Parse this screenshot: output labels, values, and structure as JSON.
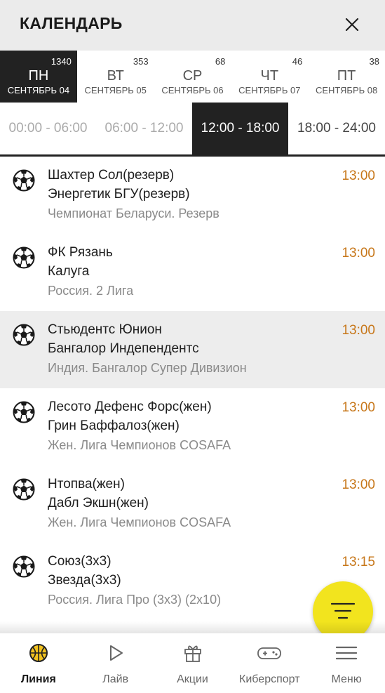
{
  "header": {
    "title": "КАЛЕНДАРЬ",
    "close_icon": "close-icon"
  },
  "days": [
    {
      "count": "1340",
      "name": "ПН",
      "date": "СЕНТЯБРЬ 04",
      "active": true
    },
    {
      "count": "353",
      "name": "ВТ",
      "date": "СЕНТЯБРЬ 05",
      "active": false
    },
    {
      "count": "68",
      "name": "СР",
      "date": "СЕНТЯБРЬ 06",
      "active": false
    },
    {
      "count": "46",
      "name": "ЧТ",
      "date": "СЕНТЯБРЬ 07",
      "active": false
    },
    {
      "count": "38",
      "name": "ПТ",
      "date": "СЕНТЯБРЬ 08",
      "active": false
    }
  ],
  "slots": [
    "00:00 - 06:00",
    "06:00 - 12:00",
    "12:00 - 18:00",
    "18:00 - 24:00"
  ],
  "active_slot": "12:00 - 18:00",
  "events": [
    {
      "team1": "Шахтер Сол(резерв)",
      "team2": "Энергетик БГУ(резерв)",
      "league": "Чемпионат Беларуси. Резерв",
      "time": "13:00",
      "sport_icon": "soccer-ball-icon"
    },
    {
      "team1": "ФК Рязань",
      "team2": "Калуга",
      "league": "Россия. 2 Лига",
      "time": "13:00",
      "sport_icon": "soccer-ball-icon"
    },
    {
      "team1": "Стьюдентс Юнион",
      "team2": "Бангалор Индепендентс",
      "league": "Индия. Бангалор Супер Дивизион",
      "time": "13:00",
      "sport_icon": "soccer-ball-icon",
      "highlighted": true
    },
    {
      "team1": "Лесото Дефенс Форс(жен)",
      "team2": "Грин Баффалоз(жен)",
      "league": "Жен. Лига Чемпионов COSAFA",
      "time": "13:00",
      "sport_icon": "soccer-ball-icon"
    },
    {
      "team1": "Нтопва(жен)",
      "team2": "Дабл Экшн(жен)",
      "league": "Жен. Лига Чемпионов COSAFA",
      "time": "13:00",
      "sport_icon": "soccer-ball-icon"
    },
    {
      "team1": "Союз(3х3)",
      "team2": "Звезда(3х3)",
      "league": "Россия. Лига Про (3х3) (2х10)",
      "time": "13:15",
      "sport_icon": "soccer-ball-icon"
    }
  ],
  "fab": {
    "icon": "filter-icon",
    "color": "#f2e41e"
  },
  "bottom_nav": [
    {
      "label": "Линия",
      "icon": "basketball-icon",
      "active": true
    },
    {
      "label": "Лайв",
      "icon": "play-icon",
      "active": false
    },
    {
      "label": "Акции",
      "icon": "gift-icon",
      "active": false
    },
    {
      "label": "Киберспорт",
      "icon": "gamepad-icon",
      "active": false
    },
    {
      "label": "Меню",
      "icon": "menu-icon",
      "active": false
    }
  ],
  "colors": {
    "accent": "#f2e41e",
    "time": "#c7771a",
    "active_bg": "#222222"
  }
}
